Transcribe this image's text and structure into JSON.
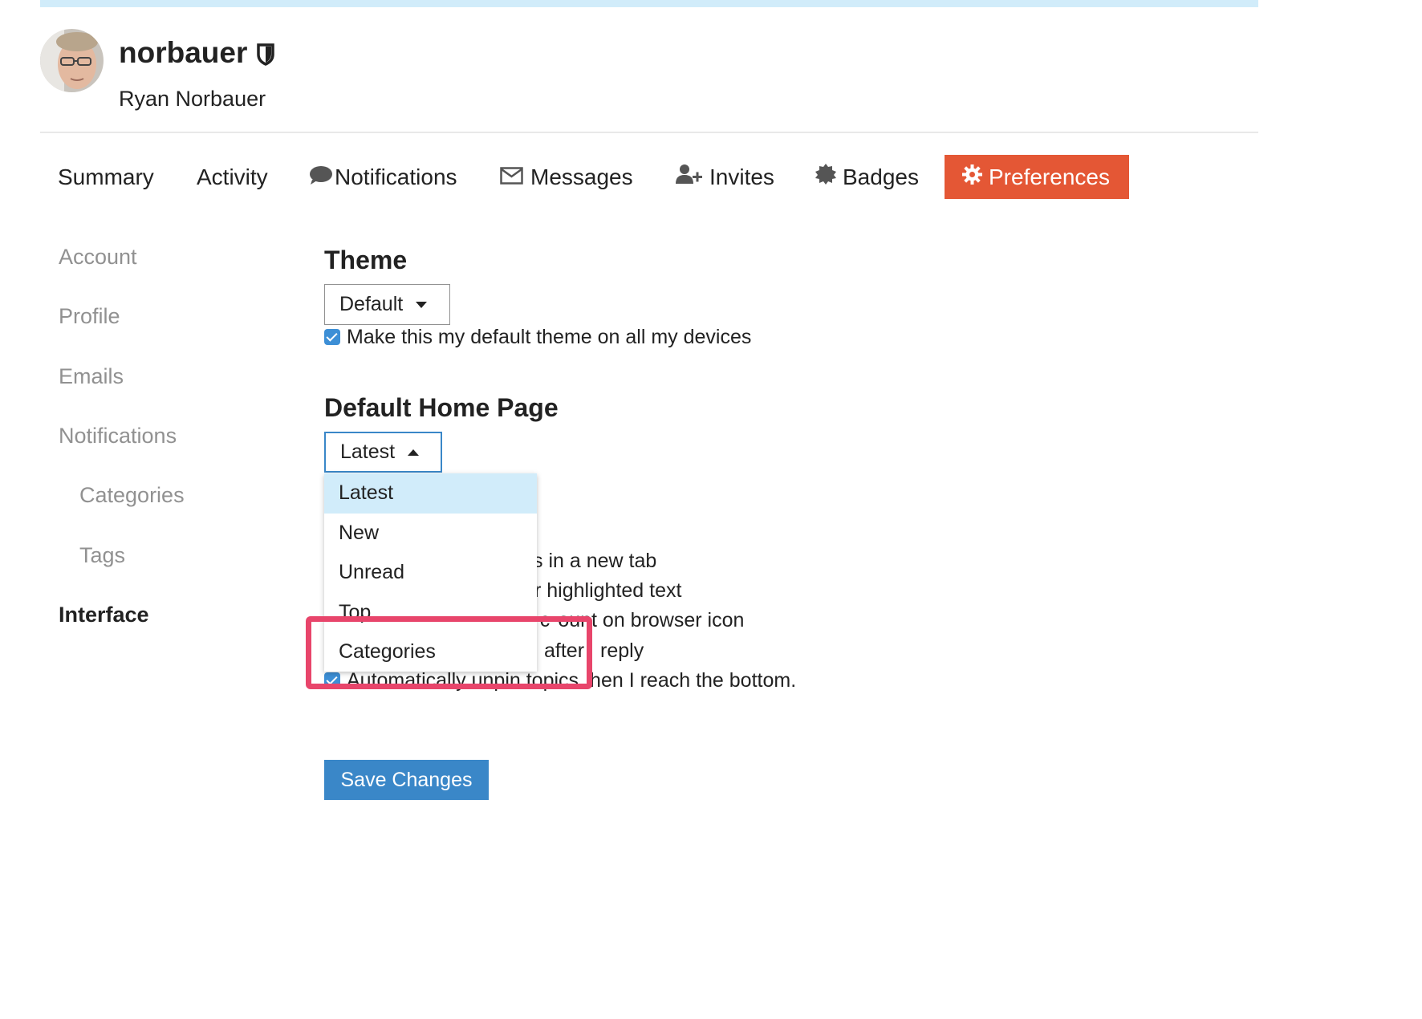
{
  "user": {
    "username": "norbauer",
    "full_name": "Ryan Norbauer"
  },
  "nav": {
    "summary": "Summary",
    "activity": "Activity",
    "notifications": "Notifications",
    "messages": "Messages",
    "invites": "Invites",
    "badges": "Badges",
    "preferences": "Preferences",
    "active_color": "#e45735"
  },
  "sidebar": {
    "items": [
      "Account",
      "Profile",
      "Emails",
      "Notifications",
      "Categories",
      "Tags",
      "Interface"
    ],
    "active": "Interface"
  },
  "theme": {
    "heading": "Theme",
    "selected": "Default",
    "default_all_devices_label": "Make this my default theme on all my devices"
  },
  "home_page": {
    "heading": "Default Home Page",
    "selected": "Latest",
    "options": [
      "Latest",
      "New",
      "Unread",
      "Top",
      "Categories"
    ]
  },
  "other_options": {
    "new_tab_fragment": "s in a new tab",
    "highlighted_fragment": "r highlighted text",
    "browser_icon_fragment": "ount on browser icon",
    "browser_icon_partial": "opic c",
    "after_reply_fragment": "after",
    "reply_fragment": "reply",
    "unpin_prefix": "Automatically unpin topics",
    "unpin_suffix": "hen I reach the bottom."
  },
  "save_label": "Save Changes",
  "colors": {
    "accent": "#e45735",
    "primary": "#3a87c8",
    "highlight": "#d1ecfa",
    "annotation": "#e8456b"
  }
}
